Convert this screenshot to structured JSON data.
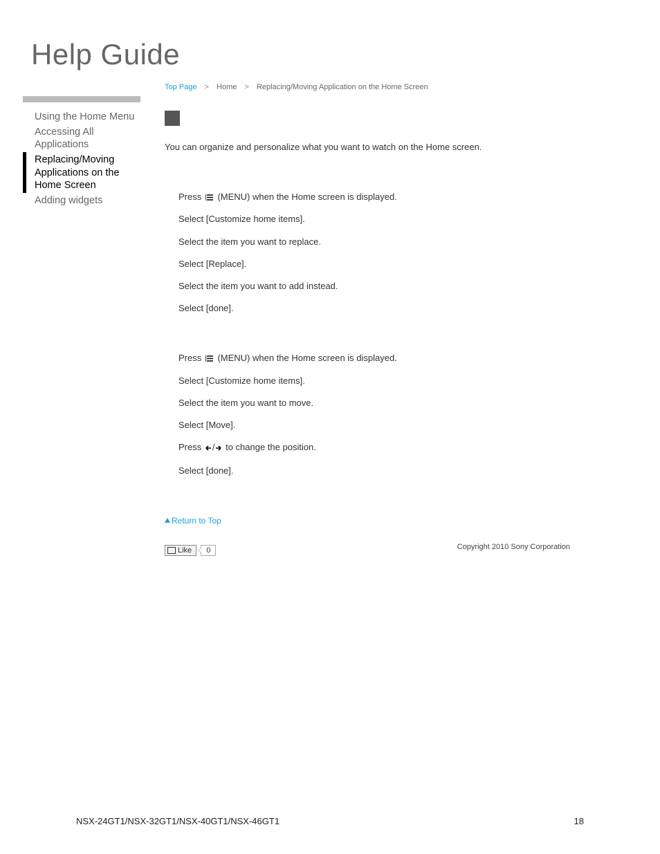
{
  "title": "Help Guide",
  "breadcrumb": {
    "top": "Top Page",
    "home": "Home",
    "current": "Replacing/Moving Application on the Home Screen"
  },
  "sidebar": {
    "items": [
      {
        "label": "Using the Home Menu"
      },
      {
        "label": "Accessing All Applications"
      },
      {
        "label": "Replacing/Moving Applications on the Home Screen"
      },
      {
        "label": "Adding widgets"
      }
    ]
  },
  "intro": "You can organize and personalize what you want to watch on the Home screen.",
  "block1": {
    "s1a": "Press ",
    "s1b": " (MENU) when the Home screen is displayed.",
    "s2": "Select [Customize home items].",
    "s3": "Select the item you want to replace.",
    "s4": "Select [Replace].",
    "s5": "Select the item you want to add instead.",
    "s6": "Select [done]."
  },
  "block2": {
    "s1a": "Press ",
    "s1b": " (MENU) when the Home screen is displayed.",
    "s2": "Select [Customize home items].",
    "s3": "Select the item you want to move.",
    "s4": "Select [Move].",
    "s5a": "Press ",
    "s5b": " to change the position.",
    "s6": "Select [done]."
  },
  "return_label": "Return to Top",
  "like": {
    "label": "Like",
    "count": "0"
  },
  "copyright": "Copyright 2010 Sony Corporation",
  "footer": {
    "models": "NSX-24GT1/NSX-32GT1/NSX-40GT1/NSX-46GT1",
    "page": "18"
  }
}
